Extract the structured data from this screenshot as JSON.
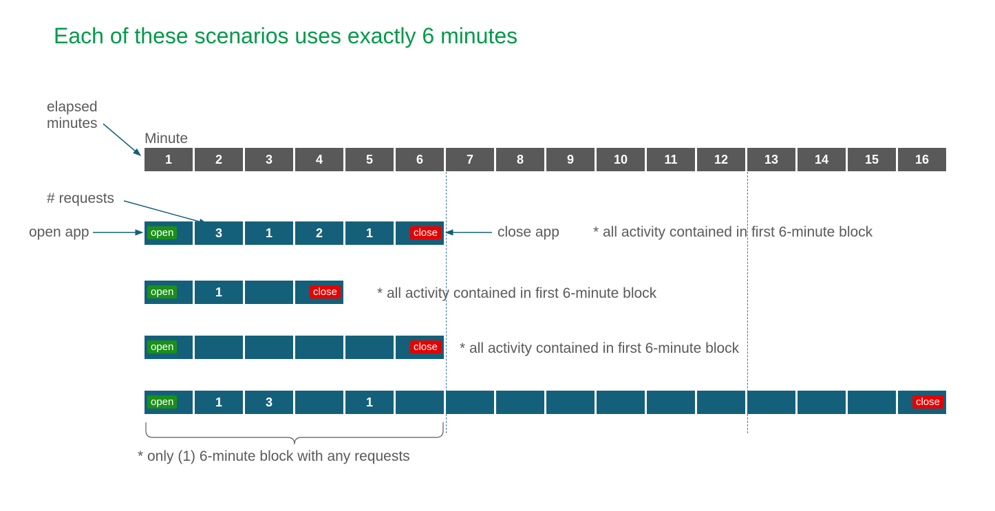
{
  "title": "Each of these scenarios uses exactly 6 minutes",
  "labels": {
    "elapsed_minutes": "elapsed\nminutes",
    "minute_header": "Minute",
    "num_requests": "# requests",
    "open_app": "open app",
    "close_app": "close app"
  },
  "badges": {
    "open": "open",
    "close": "close"
  },
  "minute_numbers": [
    "1",
    "2",
    "3",
    "4",
    "5",
    "6",
    "7",
    "8",
    "9",
    "10",
    "11",
    "12",
    "13",
    "14",
    "15",
    "16"
  ],
  "notes": {
    "n1": "* all activity contained in first 6-minute block",
    "n2": "* all activity contained in first 6-minute block",
    "n3": "* all activity contained in first 6-minute block",
    "n4": "* only (1) 6-minute block with any requests"
  },
  "chart_data": {
    "type": "table",
    "description": "Four scenario timelines over 16 minute slots. Each cell may contain open/close badge or request count; blank means idle.",
    "minutes": 16,
    "scenarios": [
      {
        "cells": [
          "open",
          "3",
          "1",
          "2",
          "1",
          "close"
        ],
        "length": 6,
        "note_key": "n1"
      },
      {
        "cells": [
          "open",
          "1",
          "",
          "close"
        ],
        "length": 4,
        "note_key": "n2"
      },
      {
        "cells": [
          "open",
          "",
          "",
          "",
          "",
          "close"
        ],
        "length": 6,
        "note_key": "n3"
      },
      {
        "cells": [
          "open",
          "1",
          "3",
          "",
          "1",
          "",
          "",
          "",
          "",
          "",
          "",
          "",
          "",
          "",
          "",
          "close"
        ],
        "length": 16,
        "note_key": "n4"
      }
    ],
    "block_dividers_after_minute": [
      6,
      12
    ]
  }
}
